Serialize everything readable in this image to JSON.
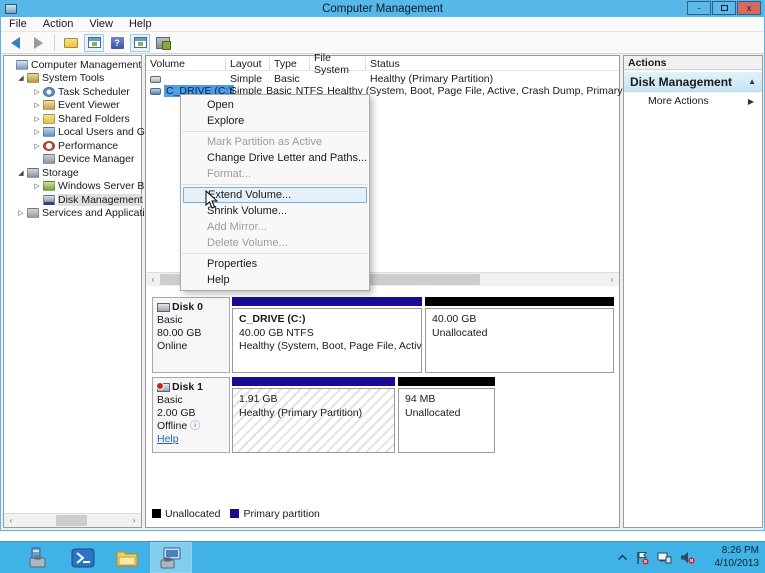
{
  "titlebar": {
    "title": "Computer Management",
    "minimize_label": "-",
    "close_label": "x"
  },
  "menubar": {
    "items": [
      "File",
      "Action",
      "View",
      "Help"
    ]
  },
  "tree": {
    "items": [
      {
        "label": "Computer Management (Local"
      },
      {
        "label": "System Tools"
      },
      {
        "label": "Task Scheduler"
      },
      {
        "label": "Event Viewer"
      },
      {
        "label": "Shared Folders"
      },
      {
        "label": "Local Users and Groups"
      },
      {
        "label": "Performance"
      },
      {
        "label": "Device Manager"
      },
      {
        "label": "Storage"
      },
      {
        "label": "Windows Server Backup"
      },
      {
        "label": "Disk Management"
      },
      {
        "label": "Services and Applications"
      }
    ]
  },
  "volume_list": {
    "headers": [
      "Volume",
      "Layout",
      "Type",
      "File System",
      "Status"
    ],
    "rows": [
      {
        "volume": "",
        "layout": "Simple",
        "type": "Basic",
        "file_system": "",
        "status": "Healthy (Primary Partition)"
      },
      {
        "volume": "C_DRIVE (C:)",
        "layout": "Simple",
        "type": "Basic",
        "file_system": "NTFS",
        "status": "Healthy (System, Boot, Page File, Active, Crash Dump, Primary Partition)"
      }
    ]
  },
  "context_menu": {
    "items": [
      {
        "label": "Open",
        "enabled": true
      },
      {
        "label": "Explore",
        "enabled": true
      },
      {
        "label": "Mark Partition as Active",
        "enabled": false
      },
      {
        "label": "Change Drive Letter and Paths...",
        "enabled": true
      },
      {
        "label": "Format...",
        "enabled": false
      },
      {
        "label": "Extend Volume...",
        "enabled": true,
        "highlighted": true
      },
      {
        "label": "Shrink Volume...",
        "enabled": true
      },
      {
        "label": "Add Mirror...",
        "enabled": false
      },
      {
        "label": "Delete Volume...",
        "enabled": false
      },
      {
        "label": "Properties",
        "enabled": true
      },
      {
        "label": "Help",
        "enabled": true
      }
    ]
  },
  "disks": [
    {
      "name": "Disk 0",
      "type": "Basic",
      "size": "80.00 GB",
      "status": "Online",
      "partitions": [
        {
          "title": "C_DRIVE (C:)",
          "line2": "40.00 GB NTFS",
          "line3": "Healthy (System, Boot, Page File, Active, Crash",
          "kind": "primary"
        },
        {
          "title": "",
          "line2": "40.00 GB",
          "line3": "Unallocated",
          "kind": "unallocated"
        }
      ]
    },
    {
      "name": "Disk 1",
      "type": "Basic",
      "size": "2.00 GB",
      "status": "Offline",
      "help_link": "Help",
      "partitions": [
        {
          "title": "",
          "line2": "1.91 GB",
          "line3": "Healthy (Primary Partition)",
          "kind": "primary"
        },
        {
          "title": "",
          "line2": "94 MB",
          "line3": "Unallocated",
          "kind": "unallocated"
        }
      ]
    }
  ],
  "legend": {
    "unallocated_label": "Unallocated",
    "primary_label": "Primary partition",
    "unallocated_color": "#000000",
    "primary_color": "#1a0b94"
  },
  "actions_panel": {
    "header": "Actions",
    "section_title": "Disk Management",
    "more_actions": "More Actions"
  },
  "taskbar": {
    "time": "8:26 PM",
    "date": "4/10/2013"
  },
  "colors": {
    "titlebar": "#56b7e8",
    "taskbar": "#40b2e5",
    "primary_partition": "#1a0b94",
    "unallocated": "#000000",
    "selection": "#4f9ee0",
    "menu_highlight": "#e4f1fb"
  }
}
